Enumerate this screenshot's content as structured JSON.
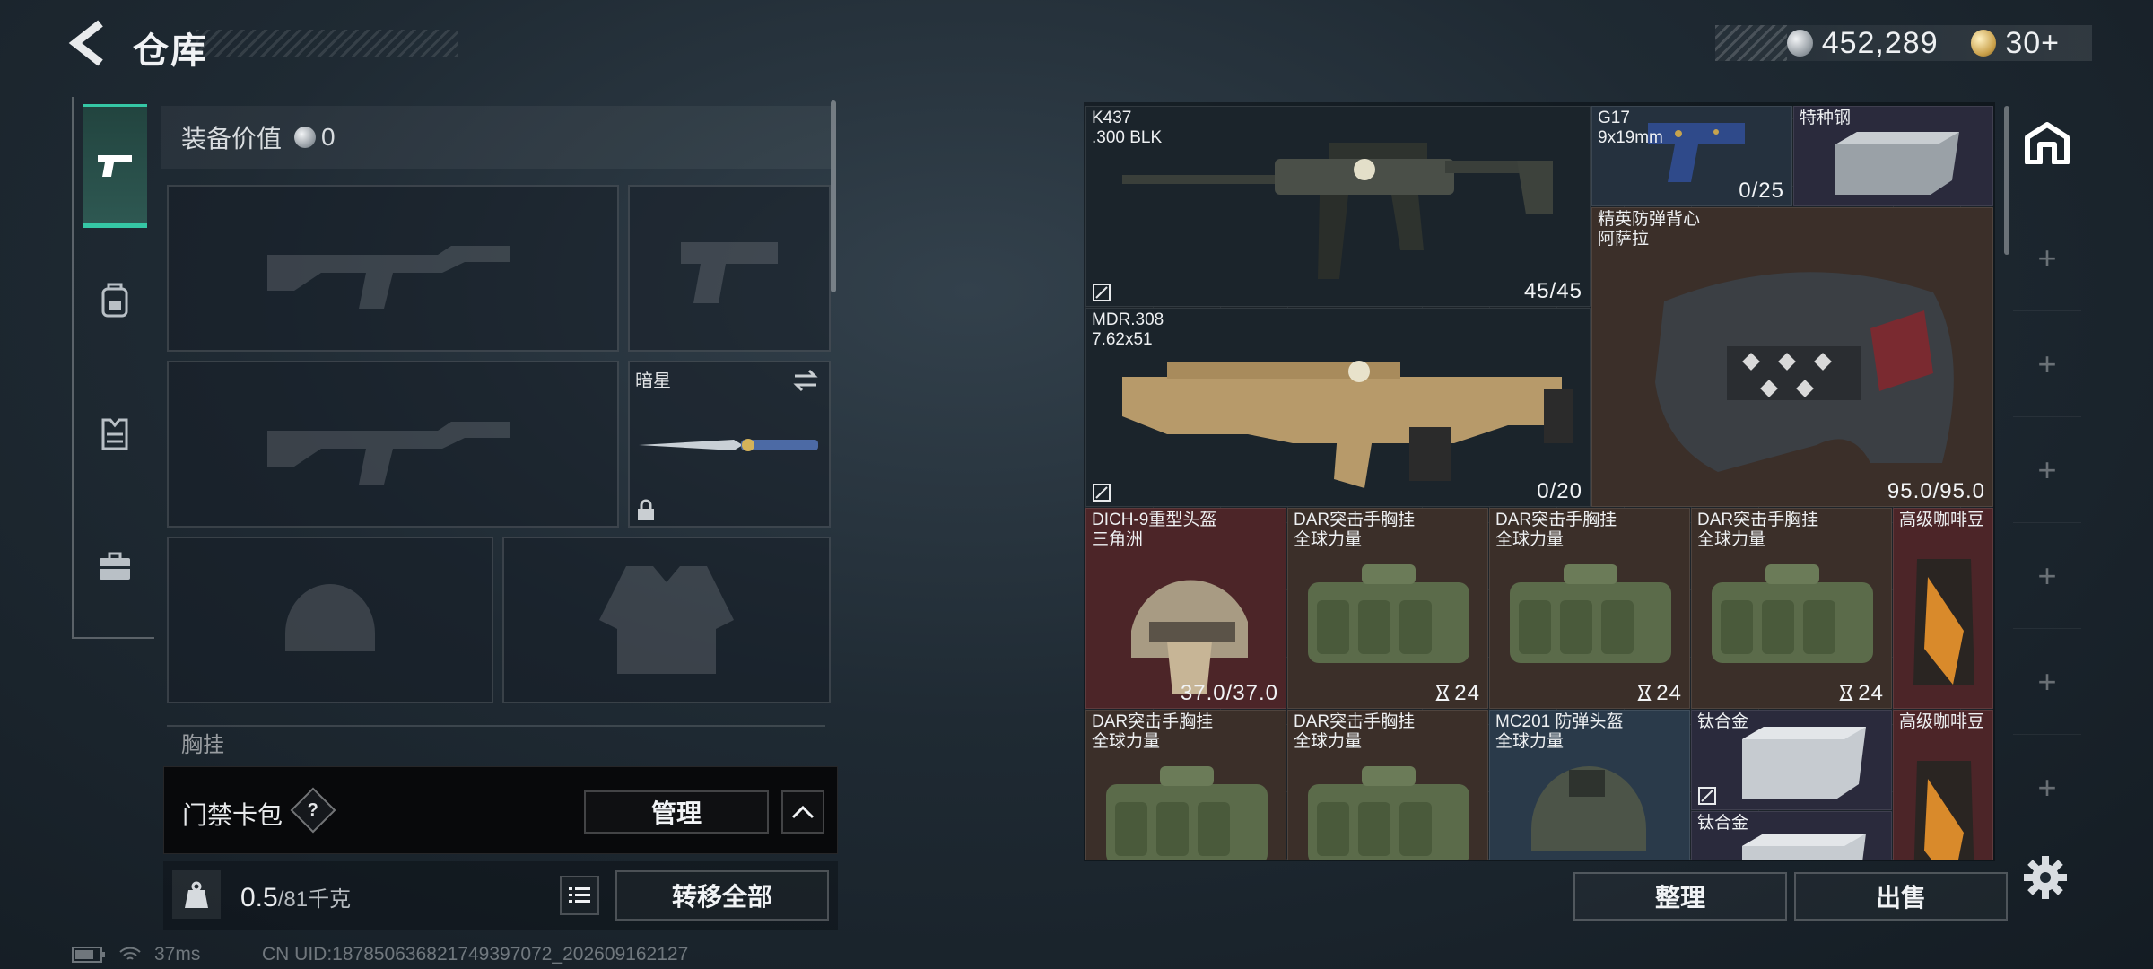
{
  "header": {
    "title": "仓库",
    "back_icon": "back-arrow-icon"
  },
  "currency": [
    {
      "icon": "silver-coin-icon",
      "value": "452,289"
    },
    {
      "icon": "gold-coin-icon",
      "value": "30+"
    }
  ],
  "rail": {
    "tabs": [
      {
        "icon": "pistol-icon",
        "active": true
      },
      {
        "icon": "backpack-icon",
        "active": false
      },
      {
        "icon": "vest-icon",
        "active": false
      },
      {
        "icon": "briefcase-icon",
        "active": false
      }
    ]
  },
  "loadout": {
    "value_label": "装备价值",
    "value": "0",
    "knife_slot_name": "暗星",
    "next_section_label": "胸挂"
  },
  "keycard": {
    "label": "门禁卡包",
    "help": "?",
    "manage_label": "管理"
  },
  "weight": {
    "current": "0.5",
    "max": "/81千克",
    "transfer_all_label": "转移全部"
  },
  "status": {
    "ping": "37ms",
    "uid": "CN UID:187850636821749397072_202609162127"
  },
  "stash": {
    "items": [
      {
        "name": "K437\n.300 BLK",
        "qty": "45/45"
      },
      {
        "name": "G17\n9x19mm",
        "qty": "0/25"
      },
      {
        "name": "特种钢",
        "qty": ""
      },
      {
        "name": "精英防弹背心\n阿萨拉",
        "qty": "95.0/95.0"
      },
      {
        "name": "MDR.308\n7.62x51",
        "qty": "0/20"
      },
      {
        "name": "DICH-9重型头盔\n三角洲",
        "qty": "37.0/37.0"
      },
      {
        "name": "DAR突击手胸挂\n全球力量",
        "qty": "24"
      },
      {
        "name": "DAR突击手胸挂\n全球力量",
        "qty": "24"
      },
      {
        "name": "DAR突击手胸挂\n全球力量",
        "qty": "24"
      },
      {
        "name": "高级咖啡豆",
        "qty": ""
      },
      {
        "name": "DAR突击手胸挂\n全球力量",
        "qty": ""
      },
      {
        "name": "DAR突击手胸挂\n全球力量",
        "qty": ""
      },
      {
        "name": "MC201 防弹头盔\n全球力量",
        "qty": ""
      },
      {
        "name": "钛合金",
        "qty": ""
      },
      {
        "name": "钛合金",
        "qty": ""
      },
      {
        "name": "高级咖啡豆",
        "qty": ""
      }
    ],
    "sort_label": "整理",
    "sell_label": "出售"
  },
  "side_tabs": {
    "add_label": "+"
  },
  "colors": {
    "accent": "#35c7a5",
    "rarity_red": "#4c2528",
    "rarity_brown": "#3b2f29",
    "rarity_purple": "#2a2a3c",
    "rarity_blue": "#25313e"
  }
}
